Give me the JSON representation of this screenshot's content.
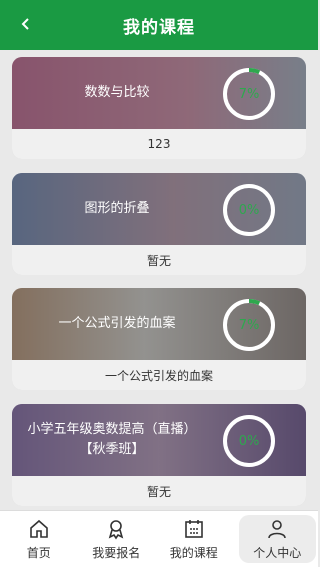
{
  "header": {
    "title": "我的课程",
    "back_icon": "chevron-left-icon"
  },
  "courses": [
    {
      "name": "数数与比较",
      "name2": "",
      "progress_label": "7%",
      "progress": 0.07,
      "footer": "123",
      "bg": "#d9669c"
    },
    {
      "name": "图形的折叠",
      "name2": "",
      "progress_label": "0%",
      "progress": 0.0,
      "footer": "暂无",
      "bg": "#5b7fb7"
    },
    {
      "name": "一个公式引发的血案",
      "name2": "",
      "progress_label": "7%",
      "progress": 0.07,
      "footer": "一个公式引发的血案",
      "bg": "#d7b48d"
    },
    {
      "name": "小学五年级奥数提高（直播）",
      "name2": "【秋季班】",
      "progress_label": "0%",
      "progress": 0.0,
      "footer": "暂无",
      "bg": "#7b5fb0"
    }
  ],
  "tabbar": {
    "items": [
      {
        "label": "首页",
        "icon": "home-icon"
      },
      {
        "label": "我要报名",
        "icon": "award-icon"
      },
      {
        "label": "我的课程",
        "icon": "calendar-icon"
      },
      {
        "label": "个人中心",
        "icon": "user-icon"
      }
    ],
    "active_index": 3
  },
  "colors": {
    "brand": "#1a9a43",
    "progress": "#2ea84e"
  }
}
